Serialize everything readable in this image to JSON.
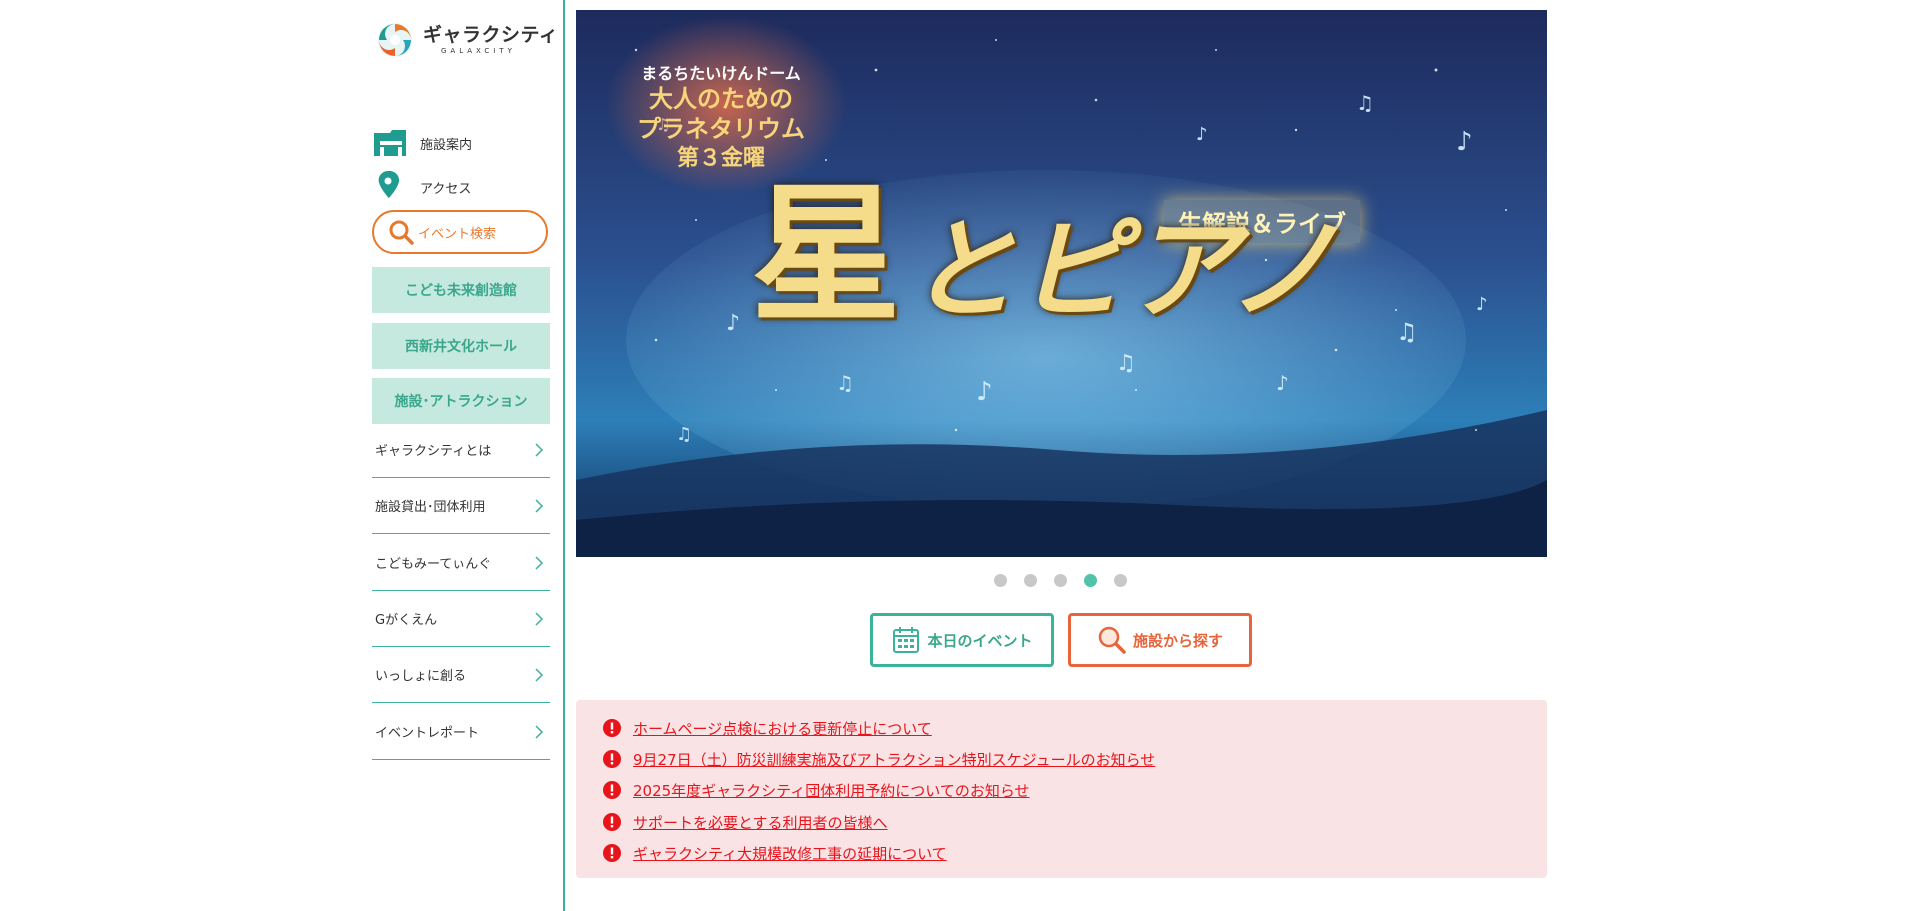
{
  "logo": {
    "jp": "ギャラクシティ",
    "en": "GALAXCITY"
  },
  "nav": {
    "facility_guide": {
      "label": "施設案内",
      "icon": "building-icon"
    },
    "access": {
      "label": "アクセス",
      "icon": "map-pin-icon"
    },
    "event_search": {
      "label": "イベント検索",
      "icon": "search-icon"
    }
  },
  "green_buttons": [
    "こども未来創造館",
    "西新井文化ホール",
    "施設･アトラクション"
  ],
  "menu": [
    "ギャラクシティとは",
    "施設貸出･団体利用",
    "こどもみーてぃんぐ",
    "Gがくえん",
    "いっしょに創る",
    "イベントレポート"
  ],
  "hero": {
    "badge_line1": "まるちたいけんドーム",
    "badge_line2": "大人のための",
    "badge_line3": "プラネタリウム",
    "badge_line4": "第３金曜",
    "subtitle": "生解説＆ライブ",
    "title_main": "星",
    "title_rest": "とピアノ"
  },
  "carousel": {
    "count": 5,
    "active": 4
  },
  "actions": {
    "today_label": "本日のイベント",
    "facility_label": "施設から探す"
  },
  "notices": [
    "ホームページ点検における更新停止について",
    "9月27日（土）防災訓練実施及びアトラクション特別スケジュールのお知らせ",
    "2025年度ギャラクシティ団体利用予約についてのお知らせ",
    "サポートを必要とする利用者の皆様へ",
    "ギャラクシティ大規模改修工事の延期について"
  ],
  "colors": {
    "teal": "#3bb39a",
    "orange": "#e8782c",
    "alert": "#e8141c",
    "notice_bg": "#f9e3e4"
  }
}
